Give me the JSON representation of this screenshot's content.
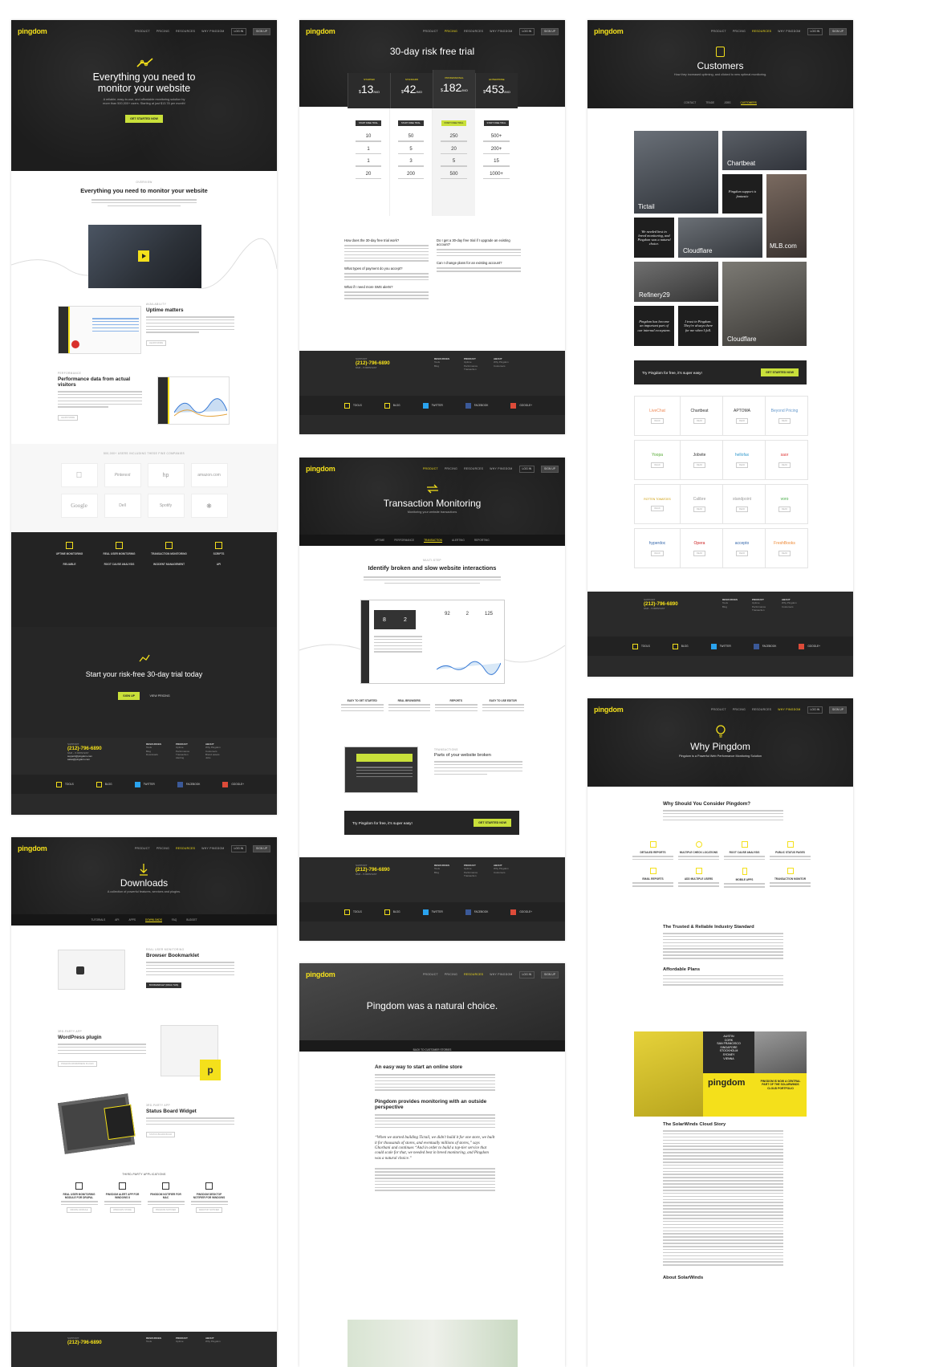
{
  "nav": {
    "logo": "pingdom",
    "product": "PRODUCT",
    "pricing": "PRICING",
    "resources": "RESOURCES",
    "why": "WHY PINGDOM",
    "login": "LOG IN",
    "signup": "SIGN UP"
  },
  "home": {
    "title": "Everything you need to monitor your website",
    "subtitle": "A reliable, easy-to-use, and affordable monitoring solution by more than 500,000+ users. Starting at just $13.78 per month!",
    "cta": "GET STARTED NOW",
    "overview_kicker": "OVERVIEW",
    "overview_title": "Everything you need to monitor your website",
    "uptime_kicker": "AVAILABILITY",
    "uptime_title": "Uptime matters",
    "uptime_btn": "LEARN MORE",
    "perf_kicker": "PERFORMANCE",
    "perf_title": "Performance data from actual visitors",
    "perf_btn": "LEARN MORE",
    "users_line": "500,000+ USERS INCLUDING THESE FINE COMPANIES",
    "companies": [
      "",
      "Pinterest",
      "hp",
      "amazon.com",
      "Google",
      "Dell",
      "Spotify",
      ""
    ],
    "features": [
      {
        "title": "UPTIME MONITORING"
      },
      {
        "title": "REAL USER MONITORING"
      },
      {
        "title": "TRANSACTION MONITORING"
      },
      {
        "title": "SCRIPTS"
      },
      {
        "title": "RELIABLE"
      },
      {
        "title": "ROOT CAUSE ANALYSIS"
      },
      {
        "title": "INCIDENT MANAGEMENT"
      },
      {
        "title": "API"
      }
    ],
    "trial_title": "Start your risk-free 30-day trial today",
    "trial_btn": "SIGN UP",
    "trial_link": "VIEW PRICING"
  },
  "footer": {
    "support": "SUPPORT",
    "phone": "(212)-796-6890",
    "hours": "9am – 5:00pm EST",
    "email1": "support@pingdom.com",
    "email2": "sales@pingdom.com",
    "col1_title": "RESOURCES",
    "col1": [
      "Tools",
      "Blog",
      "Downloads"
    ],
    "col2_title": "PRODUCT",
    "col2": [
      "Uptime",
      "Performance",
      "Transaction",
      "Alerting",
      "Enterprise",
      "Pricing"
    ],
    "col3_title": "ABOUT",
    "col3": [
      "Why Pingdom",
      "Customers",
      "Brand assets",
      "Jobs",
      "Contact"
    ],
    "tools": "TOOLS",
    "tools_sub": "Free diagnostics",
    "blog": "BLOG",
    "blog_sub": "Royal Pingdom",
    "twitter": "TWITTER",
    "twitter_sub": "Pingdom",
    "facebook": "FACEBOOK",
    "facebook_sub": "Pingdom",
    "google": "GOOGLE+",
    "google_sub": "Pingdom"
  },
  "pricing": {
    "title": "30-day risk free trial",
    "plans": [
      {
        "name": "STARTER",
        "price": "13",
        "btn": "START FREE TRIAL",
        "checks": "10",
        "rum": "1",
        "transaction": "1",
        "sms": "20"
      },
      {
        "name": "STANDARD",
        "price": "42",
        "btn": "START FREE TRIAL",
        "checks": "50",
        "rum": "5",
        "transaction": "3",
        "sms": "200"
      },
      {
        "name": "PROFESSIONAL",
        "price": "182",
        "btn": "START FREE TRIAL",
        "checks": "250",
        "rum": "20",
        "transaction": "5",
        "sms": "500"
      },
      {
        "name": "ENTERPRISE",
        "price": "453",
        "btn": "START FREE TRIAL",
        "checks": "500+",
        "rum": "200+",
        "transaction": "15",
        "sms": "1000+"
      }
    ],
    "currency": "$",
    "per": "/MO",
    "faq": [
      "How does the 30-day free trial work?",
      "What types of payment do you accept?",
      "What if I need more SMS alerts?",
      "Do I get a 30-day free trial if I upgrade an existing account?",
      "Can I change plans for an existing account?"
    ]
  },
  "customers": {
    "title": "Customers",
    "subtitle": "How they increased uptiming, and clicked to new optimal monitoring.",
    "tabs": [
      "CONTACT",
      "TRADE",
      "JOBS",
      "CUSTOMERS"
    ],
    "cards": [
      "Tictail",
      "Chartbeat",
      "MLB.com",
      "Cloudflare",
      "Refinery29",
      "Cloudflare"
    ],
    "quotes": [
      "Pingdom support is fantastic",
      "We needed best in breed monitoring, and Pingdom was a natural choice.",
      "Pingdom has become an important part of our internal ecosystem.",
      "I trust in Pingdom. They're always there for me when I fall."
    ],
    "cta_text": "Try Pingdom for free, it's super easy!",
    "cta_btn": "GET STARTED NOW",
    "logos": [
      "LiveChat",
      "Chartbeat",
      "APTOMA",
      "Beyond Pricing",
      "Yoopa",
      "Jobvite",
      "hellofax",
      "saor",
      "ROTTEN TOMATOES",
      "Calibre",
      "standpoint",
      "voro",
      "hyperdoc",
      "Opera",
      "accepto",
      "FreshBooks"
    ],
    "read": "READ"
  },
  "transaction": {
    "title": "Transaction Monitoring",
    "subtitle": "Monitoring your website transactions",
    "tabs": [
      "UPTIME",
      "PERFORMANCE",
      "TRANSACTION",
      "ALERTING",
      "REPORTING"
    ],
    "kicker": "MULTI-STEP",
    "heading": "Identify broken and slow website interactions",
    "stats": [
      "8",
      "2",
      "92",
      "2",
      "125"
    ],
    "features": [
      "EASY TO GET STARTED",
      "REAL BROWSERS",
      "REPORTS",
      "EASY TO USE EDITOR"
    ],
    "kicker2": "TRANSACTIONS",
    "heading2": "Parts of your website broken",
    "cta_text": "Try Pingdom for free, it's super easy!",
    "cta_btn": "GET STARTED NOW"
  },
  "downloads": {
    "title": "Downloads",
    "subtitle": "A collection of powerful features, services and plugins.",
    "tabs": [
      "TUTORIALS",
      "API",
      "APPS",
      "DOWNLOADS",
      "FAQ",
      "BUDGET"
    ],
    "item1_kicker": "REAL USER MONITORING",
    "item1_title": "Browser Bookmarklet",
    "item1_btn": "BOOKMARKLET (DRAG THIS)",
    "item2_kicker": "3RD-PARTY APP",
    "item2_title": "WordPress plugin",
    "item2_btn": "PINGDOM WORDPRESS PLUGIN",
    "item3_kicker": "3RD-PARTY APP",
    "item3_title": "Status Board Widget",
    "item3_btn": "STATUS BOARD BUILD",
    "third_party": "THIRD-PARTY APPLICATIONS",
    "apps": [
      {
        "title": "REAL USER MONITORING MODULE FOR DRUPAL",
        "btn": "DRUPAL MODULE"
      },
      {
        "title": "PINGDOM ALERT APP FOR WINDOWS 8",
        "btn": "WINDOWS STORE"
      },
      {
        "title": "PINGDOM NOTIFIER FOR MAC",
        "btn": "PINGDOM NOTIFIER"
      },
      {
        "title": "PINGDOM DESKTOP NOTIFIER FOR WINDOWS",
        "btn": "DESKTOP NOTIFIER"
      }
    ]
  },
  "why": {
    "title": "Why Pingdom",
    "subtitle": "Pingdom is a Powerful Web Performance Monitoring Solution",
    "q1": "Why Should You Consider Pingdom?",
    "features": [
      "DETAILED REPORTS",
      "MULTIPLE CHECK LOCATIONS",
      "ROOT CAUSE ANALYSIS",
      "PUBLIC STATUS PAGES",
      "EMAIL REPORTS",
      "ADD MULTIPLE USERS",
      "MOBILE APPS",
      "TRANSACTION MONITOR"
    ],
    "h_standard": "The Trusted & Reliable Industry Standard",
    "h_plans": "Affordable Plans",
    "cities": [
      "AUSTIN",
      "CORK",
      "SAN FRANCISCO",
      "SINGAPORE",
      "STOCKHOLM",
      "SYDNEY",
      "VIENNA"
    ],
    "banner_logo": "pingdom",
    "banner_text": "PINGDOM IS NOW A CENTRAL PART OF THE SOLARWINDS CLOUD PORTFOLIO",
    "h_story": "The SolarWinds Cloud Story",
    "h_about": "About SolarWinds"
  },
  "story": {
    "title": "Pingdom was a natural choice.",
    "back": "BACK TO CUSTOMER STORIES",
    "h1": "An easy way to start an online store",
    "h2": "Pingdom provides monitoring with an outside perspective",
    "quote": "“When we started building Tictail, we didn't build it for one store, we built it for thousands of stores, and eventually millions of stores,” says Ghorbani and continues “And in order to build a top-tier service that could scale for that, we needed best in breed monitoring, and Pingdom was a natural choice.”"
  },
  "colors": {
    "accent": "#f4e01b",
    "green": "#c9e03a",
    "dark": "#1d1d1d"
  }
}
